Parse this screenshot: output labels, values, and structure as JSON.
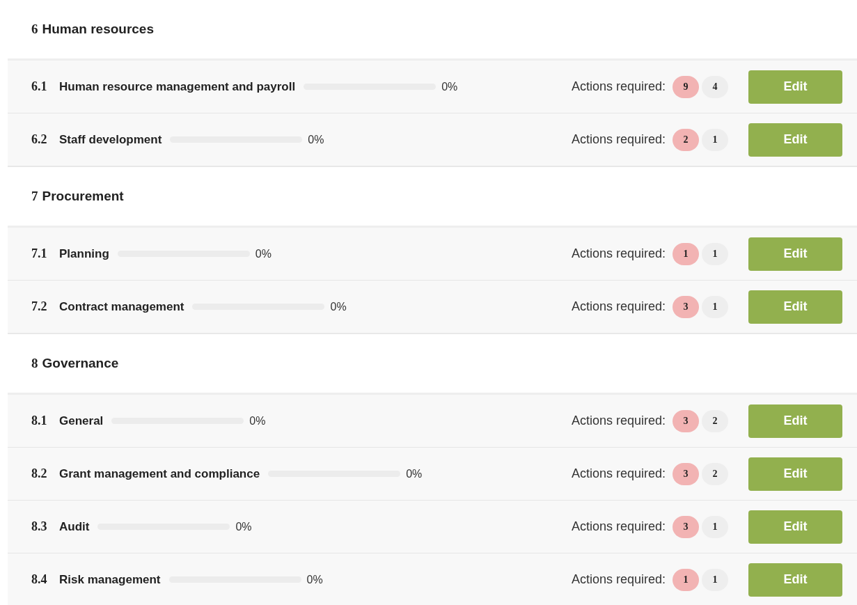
{
  "sections": [
    {
      "number": "6",
      "title": "Human resources",
      "rows": [
        {
          "number": "6.1",
          "title": "Human resource management and payroll",
          "level": 0,
          "percent": "0%",
          "actions_label": "Actions required:",
          "badges": [
            {
              "value": "9",
              "kind": "open"
            },
            {
              "value": "4",
              "kind": "total"
            }
          ],
          "button": "Edit"
        },
        {
          "number": "6.2",
          "title": "Staff development",
          "level": 0,
          "percent": "0%",
          "actions_label": "Actions required:",
          "badges": [
            {
              "value": "2",
              "kind": "open"
            },
            {
              "value": "1",
              "kind": "total"
            }
          ],
          "button": "Edit"
        }
      ]
    },
    {
      "number": "7",
      "title": "Procurement",
      "rows": [
        {
          "number": "7.1",
          "title": "Planning",
          "level": 0,
          "percent": "0%",
          "actions_label": "Actions required:",
          "badges": [
            {
              "value": "1",
              "kind": "open"
            },
            {
              "value": "1",
              "kind": "total"
            }
          ],
          "button": "Edit"
        },
        {
          "number": "7.2",
          "title": "Contract management",
          "level": 0,
          "percent": "0%",
          "actions_label": "Actions required:",
          "badges": [
            {
              "value": "3",
              "kind": "open"
            },
            {
              "value": "1",
              "kind": "total"
            }
          ],
          "button": "Edit"
        }
      ]
    },
    {
      "number": "8",
      "title": "Governance",
      "rows": [
        {
          "number": "8.1",
          "title": "General",
          "level": 0,
          "percent": "0%",
          "actions_label": "Actions required:",
          "badges": [
            {
              "value": "3",
              "kind": "open"
            },
            {
              "value": "2",
              "kind": "total"
            }
          ],
          "button": "Edit"
        },
        {
          "number": "8.2",
          "title": "Grant management and compliance",
          "level": 0,
          "percent": "0%",
          "actions_label": "Actions required:",
          "badges": [
            {
              "value": "3",
              "kind": "open"
            },
            {
              "value": "2",
              "kind": "total"
            }
          ],
          "button": "Edit"
        },
        {
          "number": "8.3",
          "title": "Audit",
          "level": 0,
          "percent": "0%",
          "actions_label": "Actions required:",
          "badges": [
            {
              "value": "3",
              "kind": "open"
            },
            {
              "value": "1",
              "kind": "total"
            }
          ],
          "button": "Edit"
        },
        {
          "number": "8.4",
          "title": "Risk management",
          "level": 0,
          "percent": "0%",
          "actions_label": "Actions required:",
          "badges": [
            {
              "value": "1",
              "kind": "open"
            },
            {
              "value": "1",
              "kind": "total"
            }
          ],
          "button": "Edit"
        }
      ]
    }
  ]
}
